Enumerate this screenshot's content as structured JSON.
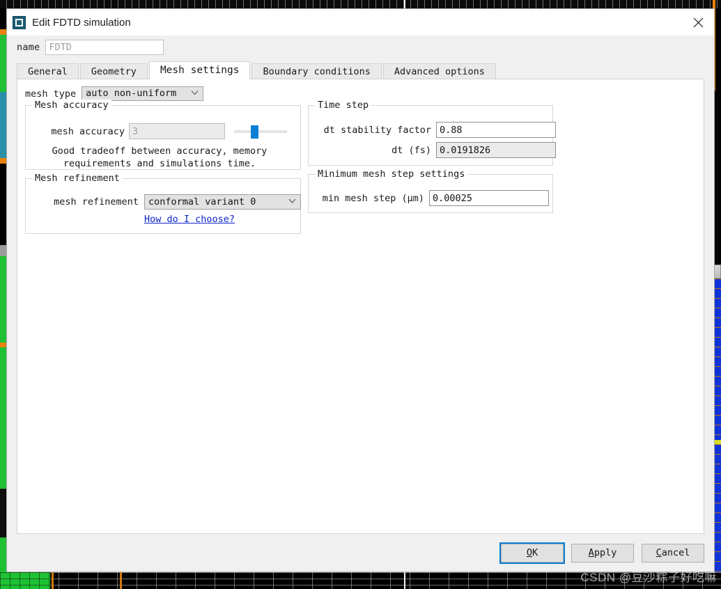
{
  "window": {
    "title": "Edit FDTD simulation",
    "icon": "fdtd-solver-icon",
    "close_icon": "close-icon"
  },
  "name_field": {
    "label": "name",
    "value": "FDTD",
    "placeholder": "FDTD"
  },
  "tabs": [
    {
      "label": "General",
      "active": false
    },
    {
      "label": "Geometry",
      "active": false
    },
    {
      "label": "Mesh settings",
      "active": true
    },
    {
      "label": "Boundary conditions",
      "active": false
    },
    {
      "label": "Advanced options",
      "active": false
    }
  ],
  "mesh_type": {
    "label": "mesh type",
    "value": "auto non-uniform",
    "chevron_icon": "chevron-down-icon"
  },
  "mesh_accuracy": {
    "legend": "Mesh accuracy",
    "label": "mesh accuracy",
    "value": "3",
    "slider_percent": 33,
    "hint_line1": "Good tradeoff between accuracy, memory",
    "hint_line2": "requirements and simulations time."
  },
  "mesh_refinement": {
    "legend": "Mesh refinement",
    "label": "mesh refinement",
    "value": "conformal variant 0",
    "chevron_icon": "chevron-down-icon",
    "help_link": "How do I choose?"
  },
  "time_step": {
    "legend": "Time step",
    "dt_stability_label": "dt stability factor",
    "dt_stability_value": "0.88",
    "dt_fs_label": "dt (fs)",
    "dt_fs_value": "0.0191826"
  },
  "min_mesh_step": {
    "legend": "Minimum mesh step settings",
    "label": "min mesh step (μm)",
    "value": "0.00025"
  },
  "buttons": {
    "ok": {
      "prefix": "",
      "mnemonic": "O",
      "suffix": "K"
    },
    "apply": {
      "prefix": "",
      "mnemonic": "A",
      "suffix": "pply"
    },
    "cancel": {
      "prefix": "",
      "mnemonic": "C",
      "suffix": "ancel"
    }
  },
  "watermark": "CSDN @豆沙粽子好吃嘛",
  "colors": {
    "accent_blue": "#0b7fd4",
    "link_blue": "#0c22c8",
    "dialog_bg": "#f0f0f0",
    "panel_bg": "#ffffff",
    "title_icon": "#1b5d75"
  }
}
